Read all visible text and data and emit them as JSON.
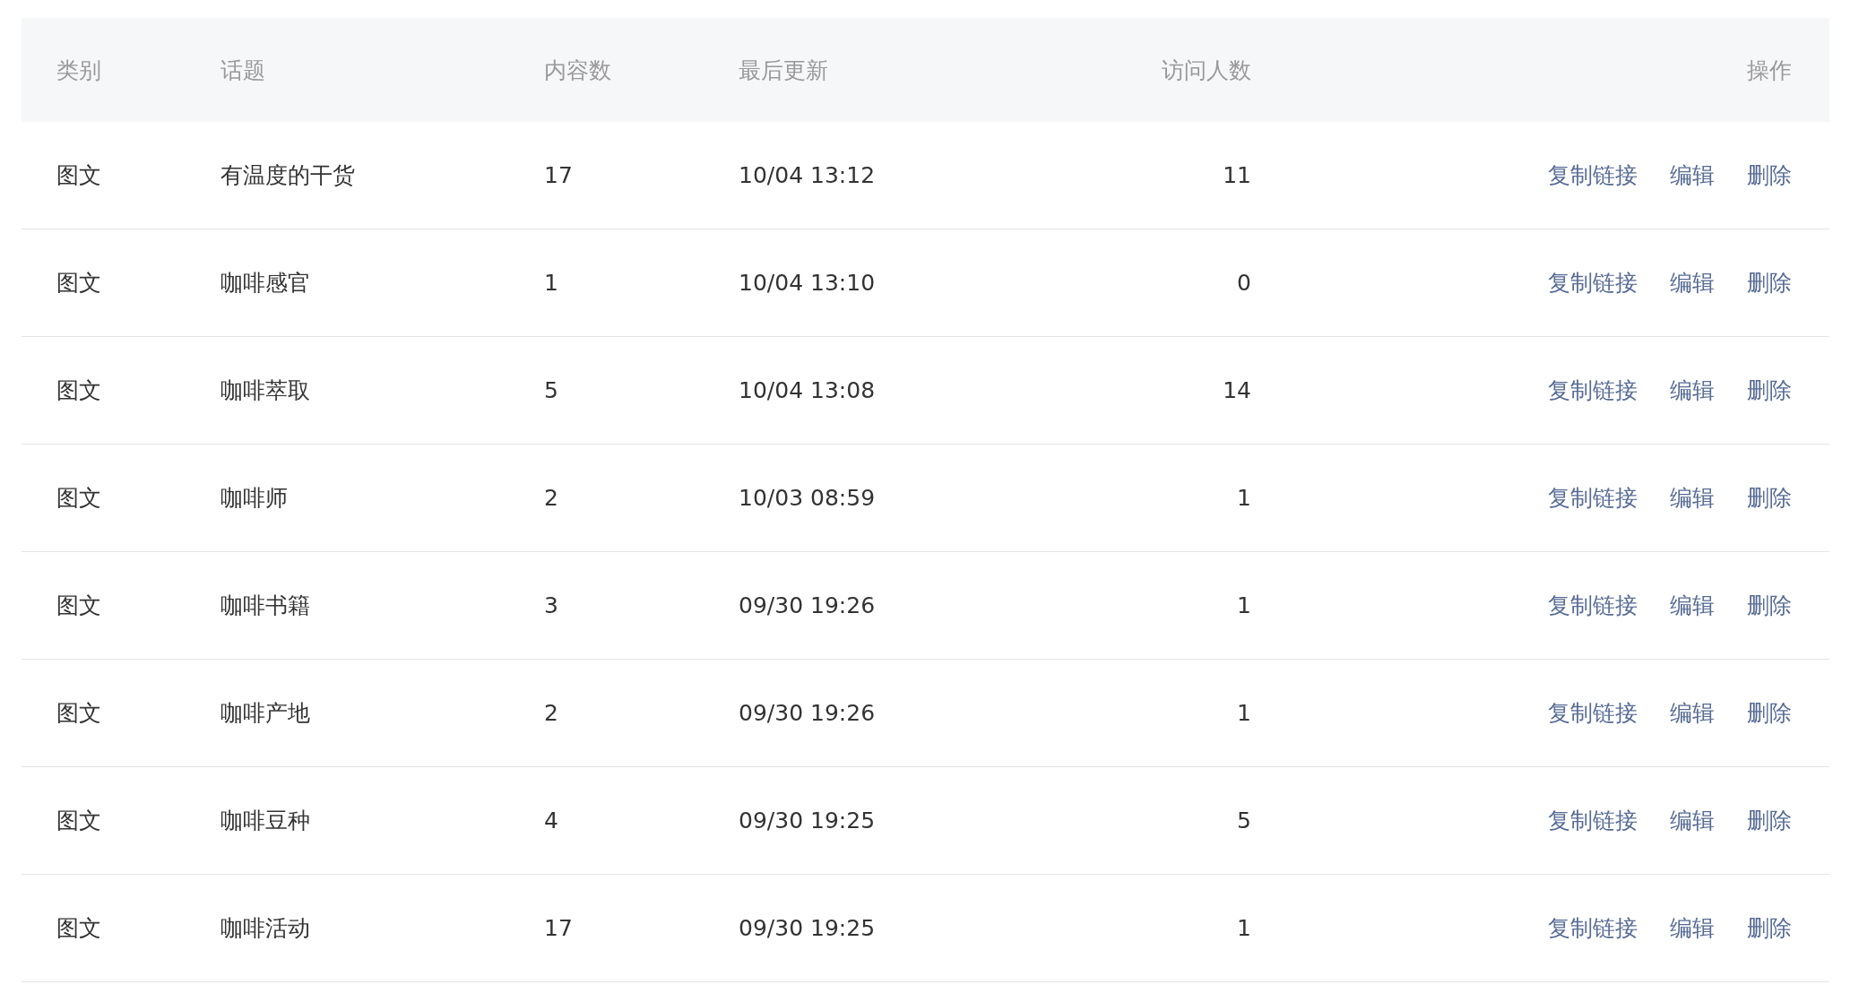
{
  "table": {
    "columns": [
      "类别",
      "话题",
      "内容数",
      "最后更新",
      "访问人数",
      "操作"
    ],
    "rows": [
      {
        "category": "图文",
        "topic": "有温度的干货",
        "count": "17",
        "updated": "10/04 13:12",
        "visitors": "11",
        "actions": [
          "复制链接",
          "编辑",
          "删除"
        ]
      },
      {
        "category": "图文",
        "topic": "咖啡感官",
        "count": "1",
        "updated": "10/04 13:10",
        "visitors": "0",
        "actions": [
          "复制链接",
          "编辑",
          "删除"
        ]
      },
      {
        "category": "图文",
        "topic": "咖啡萃取",
        "count": "5",
        "updated": "10/04 13:08",
        "visitors": "14",
        "actions": [
          "复制链接",
          "编辑",
          "删除"
        ]
      },
      {
        "category": "图文",
        "topic": "咖啡师",
        "count": "2",
        "updated": "10/03 08:59",
        "visitors": "1",
        "actions": [
          "复制链接",
          "编辑",
          "删除"
        ]
      },
      {
        "category": "图文",
        "topic": "咖啡书籍",
        "count": "3",
        "updated": "09/30 19:26",
        "visitors": "1",
        "actions": [
          "复制链接",
          "编辑",
          "删除"
        ]
      },
      {
        "category": "图文",
        "topic": "咖啡产地",
        "count": "2",
        "updated": "09/30 19:26",
        "visitors": "1",
        "actions": [
          "复制链接",
          "编辑",
          "删除"
        ]
      },
      {
        "category": "图文",
        "topic": "咖啡豆种",
        "count": "4",
        "updated": "09/30 19:25",
        "visitors": "5",
        "actions": [
          "复制链接",
          "编辑",
          "删除"
        ]
      },
      {
        "category": "图文",
        "topic": "咖啡活动",
        "count": "17",
        "updated": "09/30 19:25",
        "visitors": "1",
        "actions": [
          "复制链接",
          "编辑",
          "删除"
        ]
      }
    ]
  }
}
